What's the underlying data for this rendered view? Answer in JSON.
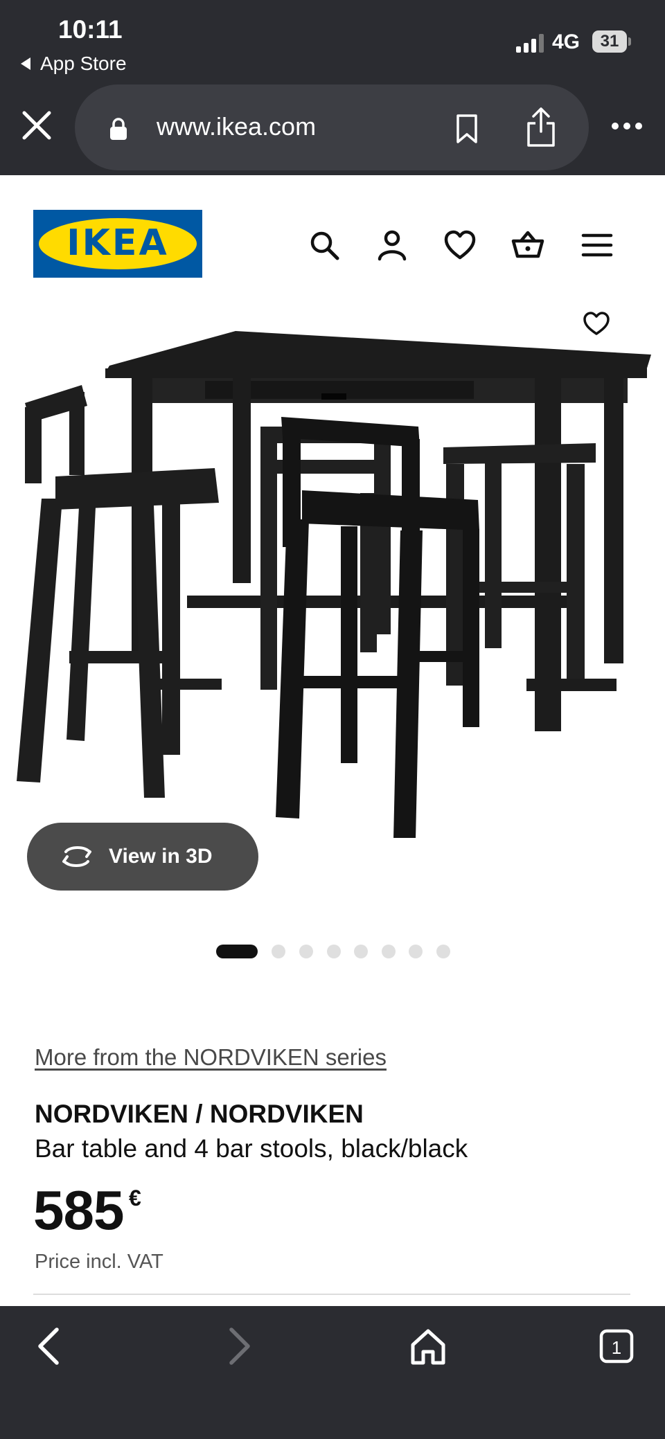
{
  "status_bar": {
    "time": "10:11",
    "back_app": "App Store",
    "network": "4G",
    "battery": "31"
  },
  "browser": {
    "url": "www.ikea.com",
    "icons": [
      "close-icon",
      "lock-icon",
      "bookmark-icon",
      "share-icon",
      "more-icon"
    ],
    "toolbar_icons": [
      "back-icon",
      "forward-icon",
      "home-icon",
      "tabs-icon"
    ],
    "tab_count": "1"
  },
  "header": {
    "logo_text": "IKEA",
    "icons": [
      "search-icon",
      "account-icon",
      "heart-icon",
      "basket-icon",
      "menu-icon"
    ]
  },
  "gallery": {
    "view_3d_label": "View in 3D",
    "slide_count": 8,
    "active_slide": 1
  },
  "product": {
    "series_link": "More from the NORDVIKEN series",
    "name": "NORDVIKEN / NORDVIKEN",
    "description": "Bar table and 4 bar stools, black/black",
    "price": "585",
    "currency": "€",
    "price_note": "Price incl. VAT"
  },
  "colors": {
    "browser_chrome": "#2b2c31",
    "ikea_blue": "#0058a3",
    "ikea_yellow": "#ffdb00",
    "view3d_pill": "#4b4b4b"
  }
}
